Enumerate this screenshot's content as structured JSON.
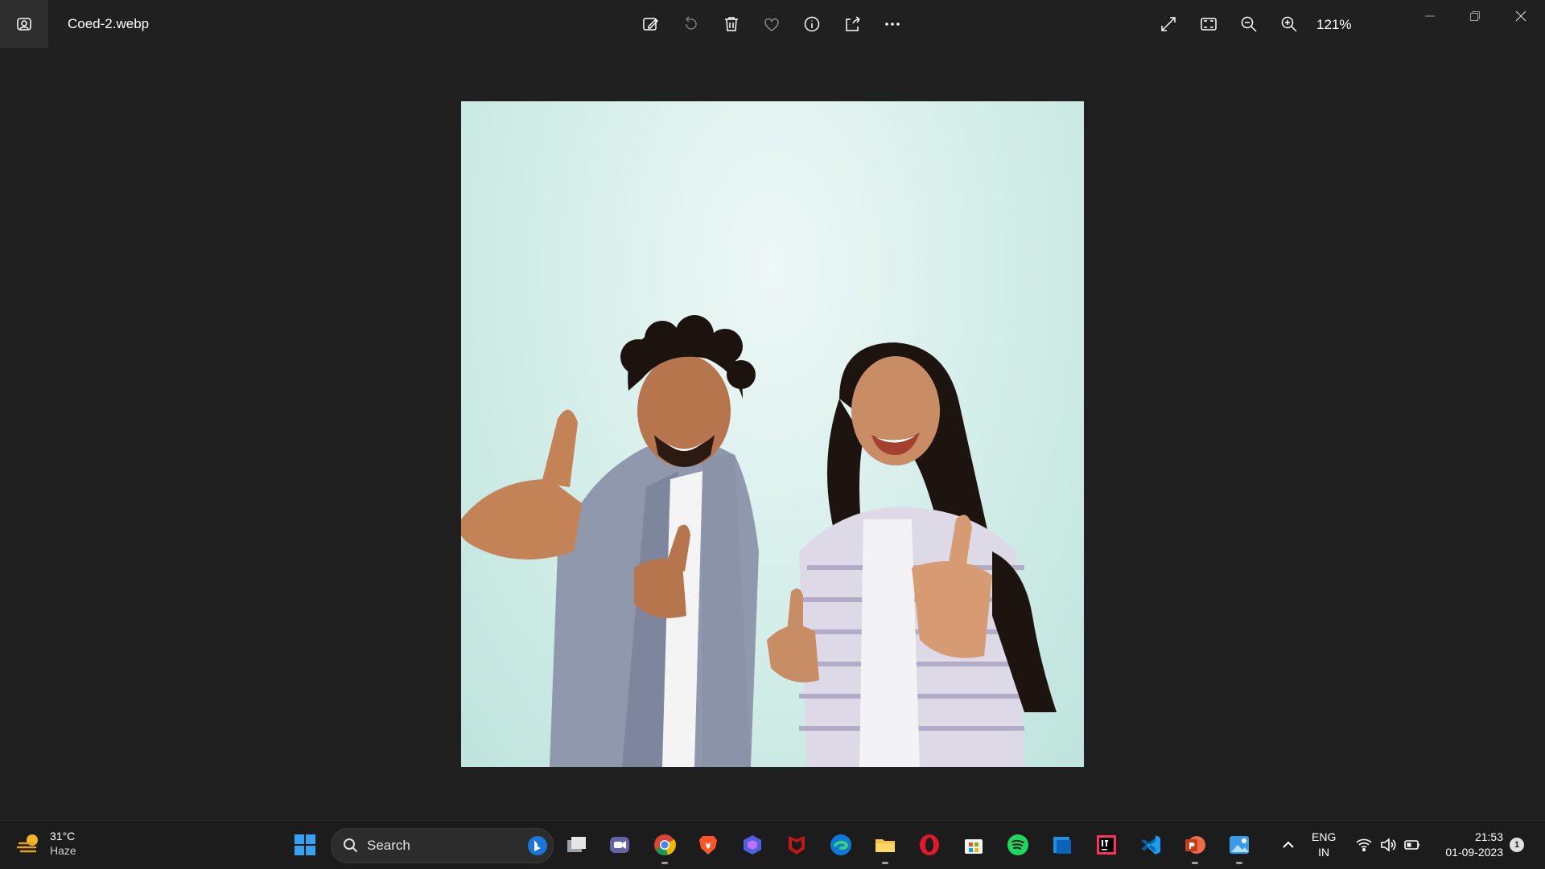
{
  "titlebar": {
    "file_name": "Coed-2.webp",
    "zoom_level": "121%",
    "tools": [
      {
        "name": "edit-image-icon"
      },
      {
        "name": "rotate-icon"
      },
      {
        "name": "delete-icon"
      },
      {
        "name": "favorite-icon"
      },
      {
        "name": "info-icon"
      },
      {
        "name": "share-icon"
      },
      {
        "name": "more-options-icon"
      },
      {
        "name": "full-screen-icon"
      },
      {
        "name": "fit-to-window-icon"
      },
      {
        "name": "zoom-out-icon"
      },
      {
        "name": "zoom-in-icon"
      }
    ]
  },
  "taskbar": {
    "weather": {
      "temperature": "31°C",
      "condition": "Haze"
    },
    "search_label": "Search",
    "language": {
      "line1": "ENG",
      "line2": "IN"
    },
    "clock": {
      "time": "21:53",
      "date": "01-09-2023"
    },
    "notification_count": "1",
    "colors": {
      "accent": "#0078d4",
      "background": "#1c1c1c"
    }
  }
}
